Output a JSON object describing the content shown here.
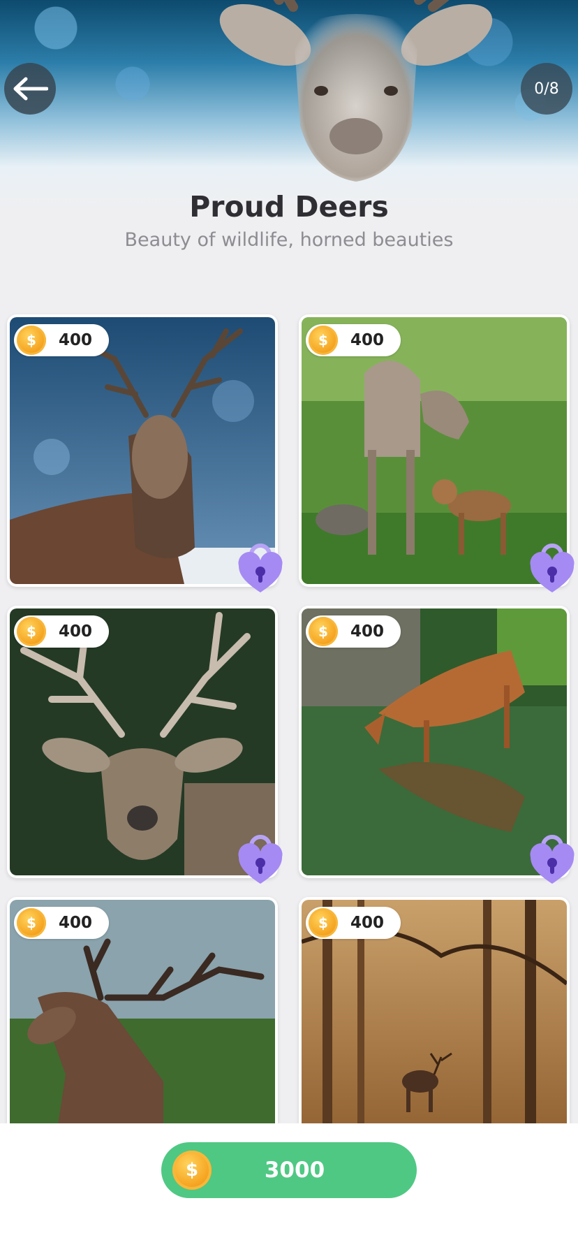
{
  "header": {
    "back_icon": "arrow-left-icon",
    "progress": "0/8",
    "title": "Proud Deers",
    "subtitle": "Beauty of wildlife, horned beauties"
  },
  "cards": [
    {
      "price": "400",
      "scene": "stag-in-snow",
      "locked": true
    },
    {
      "price": "400",
      "scene": "doe-with-fawn",
      "locked": true
    },
    {
      "price": "400",
      "scene": "stag-portrait",
      "locked": true
    },
    {
      "price": "400",
      "scene": "fawn-drinking-water",
      "locked": true
    },
    {
      "price": "400",
      "scene": "roaring-stag",
      "locked": false
    },
    {
      "price": "400",
      "scene": "stag-in-autumn-forest",
      "locked": false
    }
  ],
  "balance": {
    "coin_icon": "coin-icon",
    "amount": "3000"
  },
  "colors": {
    "accent_green": "#4fc883",
    "lock_purple": "#9a7cf2",
    "coin_gold": "#f6a623"
  }
}
